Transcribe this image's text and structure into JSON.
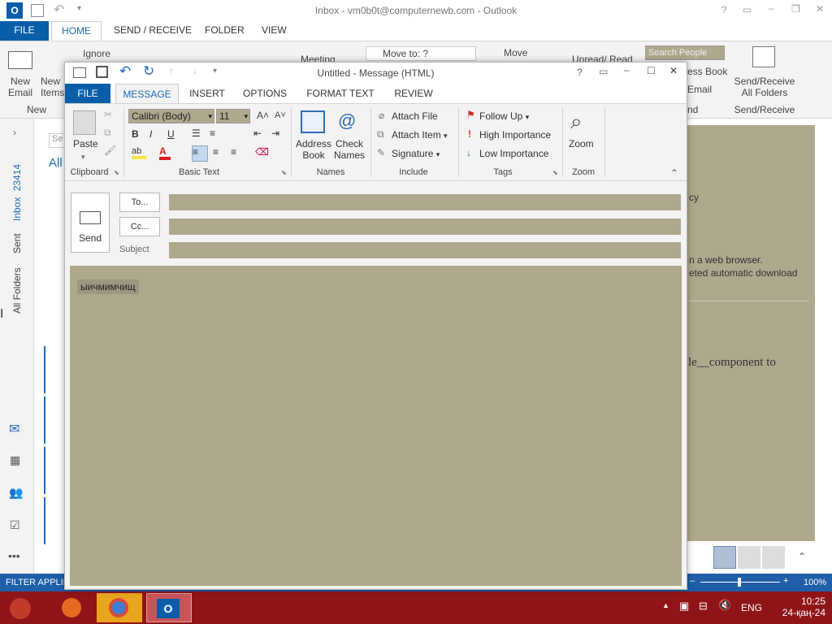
{
  "main_window": {
    "title": "Inbox - vm0b0t@computernewb.com - Outlook",
    "tabs": [
      "FILE",
      "HOME",
      "SEND / RECEIVE",
      "FOLDER",
      "VIEW"
    ],
    "ribbon": {
      "new_email": [
        "New",
        "Email"
      ],
      "new_items": [
        "New",
        "Items"
      ],
      "new_group": "New",
      "ignore": "Ignore",
      "meeting": "Meeting",
      "move_to": "Move to: ?",
      "move": "Move",
      "unread_read": "Unread/ Read",
      "search_people": "Search People",
      "address_book": "ess Book",
      "email": "Email",
      "find_label": "nd",
      "send_receive_all": [
        "Send/Receive",
        "All Folders"
      ],
      "send_receive_group": "Send/Receive"
    },
    "left_rail": {
      "inbox_label": "Inbox",
      "inbox_count": "23414",
      "sent_label": "Sent",
      "all_folders_label": "All Folders"
    },
    "folder_pane": {
      "search_placeholder": "Se",
      "all_label": "All"
    },
    "reading_pane_fragments": [
      "cy",
      "n a web browser.",
      "eted automatic download",
      "le__component to"
    ],
    "status": {
      "filter": "FILTER APPLIED",
      "zoom": "100%"
    }
  },
  "compose": {
    "title": "Untitled - Message (HTML)",
    "tabs": [
      "FILE",
      "MESSAGE",
      "INSERT",
      "OPTIONS",
      "FORMAT TEXT",
      "REVIEW"
    ],
    "ribbon": {
      "paste": "Paste",
      "clipboard_group": "Clipboard",
      "font_name": "Calibri (Body)",
      "font_size": "11",
      "basic_text_group": "Basic Text",
      "address_book": [
        "Address",
        "Book"
      ],
      "check_names": [
        "Check",
        "Names"
      ],
      "names_group": "Names",
      "attach_file": "Attach File",
      "attach_item": "Attach Item",
      "signature": "Signature",
      "include_group": "Include",
      "follow_up": "Follow Up",
      "high_importance": "High Importance",
      "low_importance": "Low Importance",
      "tags_group": "Tags",
      "zoom": "Zoom",
      "zoom_group": "Zoom"
    },
    "header": {
      "send": "Send",
      "to": "To...",
      "cc": "Cc...",
      "subject_label": "Subject"
    },
    "body_text": "ыичмимчищ"
  },
  "taskbar": {
    "language": "ENG",
    "time": "10:25",
    "date": "24-қаң-24"
  },
  "colors": {
    "accent": "#0a5ea8",
    "status_bar": "#1f5ea8",
    "taskbar": "#8f1418",
    "field_fill": "#aea88d"
  }
}
